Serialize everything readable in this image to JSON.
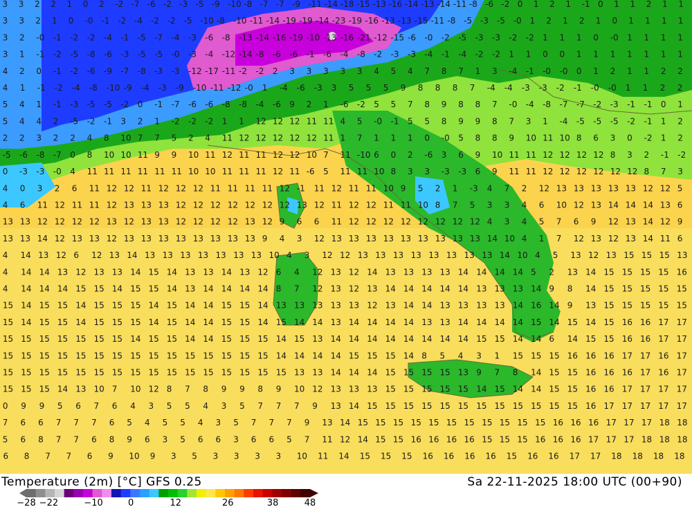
{
  "header": {
    "title_left": "Temperature (2m) [°C] GFS 0.25",
    "title_right": "Sa 22-11-2025 18:00 UTC (00+90)"
  },
  "colorbar": {
    "ticks": [
      "-28",
      "-22",
      "-10",
      "0",
      "12",
      "26",
      "38",
      "48"
    ],
    "colors": [
      "#6e6e6e",
      "#8e8e8e",
      "#b4b4b4",
      "#d6d6d6",
      "#6b007a",
      "#9b00b4",
      "#c800dc",
      "#e05ad0",
      "#f08cf0",
      "#1414b4",
      "#1e3cff",
      "#3c78ff",
      "#2aa0ff",
      "#3cc8ff",
      "#00a000",
      "#00be00",
      "#28d228",
      "#a0e632",
      "#f0f000",
      "#ffe650",
      "#ffc800",
      "#ffa000",
      "#ff7800",
      "#ff3c00",
      "#e61400",
      "#c80000",
      "#a00000",
      "#800000",
      "#600000",
      "#400000"
    ]
  },
  "map": {
    "background_color": "#fcd34d",
    "label_rows": [
      "3 3 2 2 1 0 2 -2 -7 -6 -2 -3 -5 -9 -10 -8 -7 -7 -9 -11 -14 -18 -15 -13 -16 -14 -13 -14 -11 -8 -6 -2 0 1 2 1 -1 0 1 1 2 1 1",
      "3 3 2 1 0 -0 -1 -2 -4 -2 -2 -5 -10 -8 -10 -11 -14 -19 -19 -14 -23 -19 -16 -13 -13 -15 -11 -8 -5 -3 -5 -0 1 2 1 2 1 0 1 1 1 1",
      "3 2 -0 -1 -2 -2 -4 -1 -5 -7 -4 -3 -6 -8 -13 -14 -16 -19 -10 -13 -16 -21 -12 -15 -6 -0 -2 -5 -3 -3 -2 -2 1 1 1 0 -0 1 1 1 1",
      "3 1 -1 -2 -5 -8 -6 -3 -5 -5 -0 -3 -4 -12 -14 -8 -6 -6 -1 -6 -4 -8 -2 -3 -3 -4 -1 -4 -2 -2 1 1 0 0 1 1 1 1 1 1 1",
      "4 2 0 -1 -2 -6 -9 -7 -8 -3 -3 -12 -17 -11 -2 -2 2 3 3 3 3 3 4 5 4 7 8 7 1 3 -4 -1 -0 -0 0 1 2 1 1 2 2",
      "4 1 -1 -2 -4 -8 -10 -9 -4 -3 -9 -10 -11 -12 -0 1 -4 -6 -3 3 5 5 5 9 8 8 8 7 -4 -4 -3 -3 -2 -1 -0 -0 1 1 2 2",
      "5 4 1 -1 -3 -5 -5 -2 0 -1 -7 -6 -6 -8 -8 -4 -6 9 2 1 -6 -2 5 5 7 8 9 8 8 7 -0 -4 -8 -7 -7 -2 -3 -1 -1 0 1",
      "5 4 4 2 -5 -2 -1 3 2 1 -2 -2 -2 1 1 12 12 12 11 11 4 5 -0 -1 5 5 8 9 9 8 7 3 1 -4 -5 -5 -5 -2 -1 1 2",
      "2 2 3 2 2 4 8 10 7 7 5 2 4 11 12 12 12 12 12 11 1 7 1 1 1 0 -0 5 8 8 9 10 11 10 8 6 3 0 -2 1 2",
      "-5 -6 -8 -7 0 8 10 10 11 9 9 10 11 12 11 11 12 12 10 7 11 -10 6 0 2 -6 3 6 9 10 11 11 12 12 12 12 8 3 2 -1 -2",
      "0 -3 -3 -0 4 11 11 11 11 11 11 10 10 11 11 11 12 11 -6 5 11 11 10 8 3 3 -3 -3 6 9 11 11 12 12 12 12 12 12 8 7 3",
      "4 0 3 2 6 11 12 12 11 12 12 12 11 11 11 11 12 -1 11 12 11 11 10 9 5 2 1 -3 4 7 2 12 13 13 13 13 13 12 12 5",
      "4 6 11 12 11 11 12 13 13 13 12 12 12 12 12 12 12 13 12 11 12 12 11 11 10 8 7 5 3 3 4 6 10 12 13 14 14 14 13 6",
      "13 13 12 12 12 12 13 12 13 13 12 12 12 12 13 12 9 6 6 11 12 12 12 12 12 12 12 12 4 3 4 5 7 6 9 12 13 14 12 9",
      "13 13 14 12 13 13 12 13 13 13 13 13 13 13 13 9 4 3 12 13 13 13 13 13 13 13 13 13 14 10 4 1 7 12 13 12 13 14 11 6",
      "4 14 13 12 6 12 13 14 13 13 13 13 13 13 13 10 4 3 12 12 13 13 13 13 13 13 13 13 14 10 4 5 13 12 13 15 15 15 13",
      "4 14 14 13 12 13 13 14 15 14 13 13 14 13 12 6 4 12 13 12 14 13 13 13 13 14 14 14 14 5 2 13 14 15 15 15 15 16",
      "4 14 14 14 15 15 14 15 15 14 13 14 14 14 14 8 7 12 13 12 13 14 14 14 14 14 13 13 13 14 9 8 14 15 15 15 15 15",
      "15 14 15 15 14 15 15 15 14 15 14 14 15 15 14 13 13 13 13 13 12 13 14 14 13 13 13 13 14 16 14 9 13 15 15 15 15 15",
      "15 14 15 15 14 15 15 15 14 15 14 14 15 15 14 15 14 14 13 14 14 14 14 13 13 14 14 14 14 15 14 15 14 15 16 16 17 17",
      "15 15 15 15 15 15 15 14 15 15 14 14 15 15 15 14 15 13 14 14 14 14 14 14 14 14 15 15 14 14 6 14 15 15 16 16 17 17",
      "15 15 15 15 15 15 15 15 15 15 15 15 15 15 15 14 14 14 14 15 15 15 14 8 5 4 3 1 15 15 15 16 16 16 17 17 16 17",
      "15 15 15 15 15 15 15 15 15 15 15 15 15 15 15 15 13 13 14 14 14 15 15 15 15 13 9 7 8 14 15 15 16 16 16 17 16 17",
      "15 15 15 14 13 10 7 10 12 8 7 8 9 9 8 9 10 12 13 13 13 15 15 15 15 15 14 15 14 14 15 15 16 16 17 17 17 17",
      "0 9 9 5 6 7 6 4 3 5 5 4 3 5 7 7 7 9 13 14 15 15 15 15 15 15 15 15 15 15 15 15 16 17 17 17 17 17",
      "7 6 6 7 7 7 6 5 4 5 5 4 3 5 7 7 7 9 13 14 15 15 15 15 15 15 15 15 15 15 15 16 16 16 17 17 17 18 18",
      "5 6 8 7 7 6 8 9 6 3 5 6 6 3 6 6 5 7 11 12 14 15 15 16 16 16 16 15 15 15 16 16 16 17 17 17 18 18 18",
      "6 8 7 7 6 9 10 9 3 5 3 3 3 3 10 11 14 15 15 15 16 16 16 16 15 16 16 17 17 18 18 18 18"
    ]
  }
}
